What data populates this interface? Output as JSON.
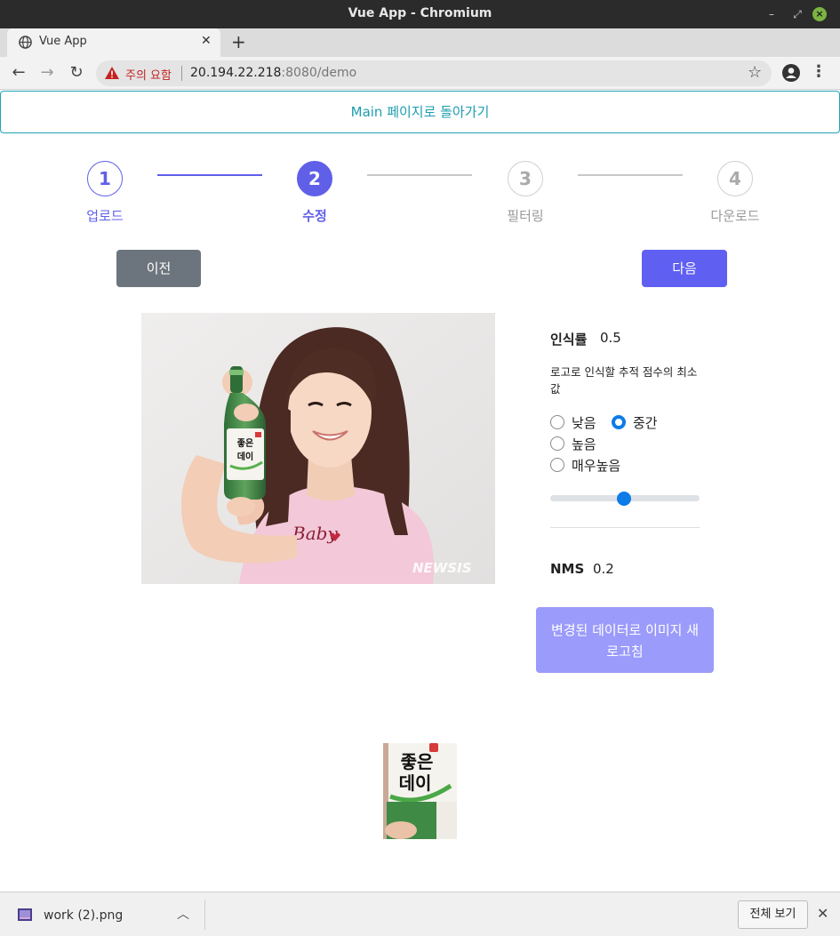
{
  "window": {
    "title": "Vue App - Chromium"
  },
  "browser": {
    "tab_title": "Vue App",
    "security_warning": "주의 요함",
    "url_host": "20.194.22.218",
    "url_rest": ":8080/demo"
  },
  "app": {
    "back_link": "Main 페이지로 돌아가기",
    "steps": [
      {
        "number": "1",
        "label": "업로드",
        "state": "done"
      },
      {
        "number": "2",
        "label": "수정",
        "state": "current"
      },
      {
        "number": "3",
        "label": "필터링",
        "state": "todo"
      },
      {
        "number": "4",
        "label": "다운로드",
        "state": "todo"
      }
    ],
    "prev_button": "이전",
    "next_button": "다음",
    "settings": {
      "confidence_title": "인식률",
      "confidence_value": "0.5",
      "confidence_desc": "로고로 인식할 추적 점수의 최소값",
      "options": [
        {
          "label": "낮음",
          "selected": false
        },
        {
          "label": "중간",
          "selected": true
        },
        {
          "label": "높음",
          "selected": false
        },
        {
          "label": "매우높음",
          "selected": false
        }
      ],
      "slider_value": 0.5,
      "nms_title": "NMS",
      "nms_value": "0.2",
      "refresh_button": "변경된 데이터로 이미지 새로고침"
    },
    "photo_watermark": "NEWSIS",
    "label_text": "좋은데이"
  },
  "downloads": {
    "file_name": "work (2).png",
    "show_all": "전체 보기"
  },
  "colors": {
    "accent": "#5f5fe8",
    "link": "#1c9db0",
    "radio": "#0d7be8",
    "warning": "#c5221f"
  }
}
